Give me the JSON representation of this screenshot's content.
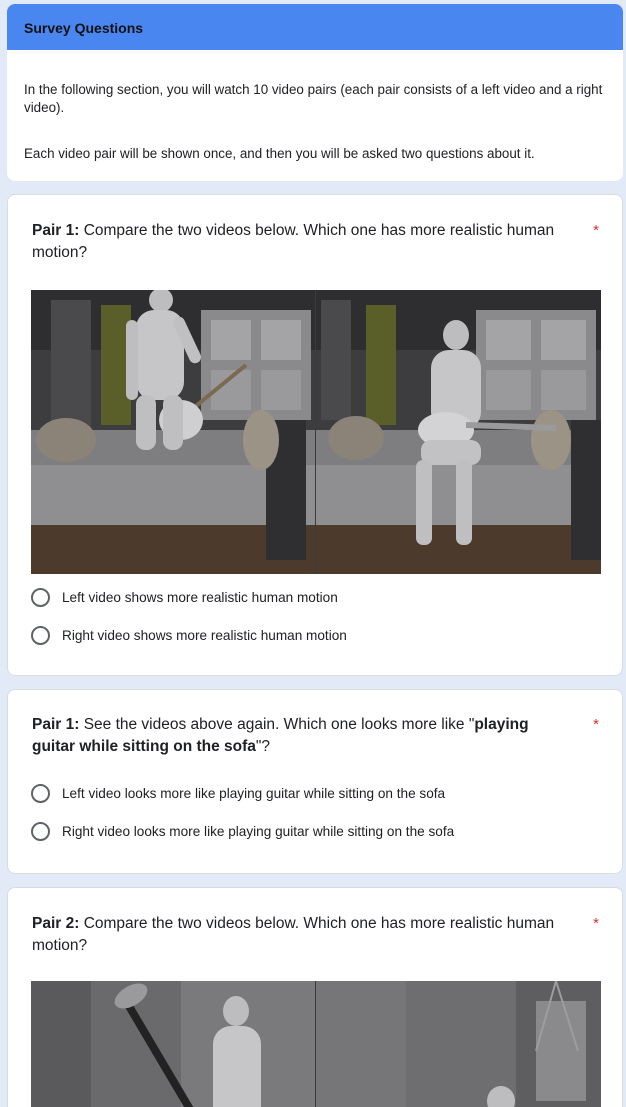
{
  "section": {
    "title": "Survey Questions",
    "intro_p1": "In the following section, you will watch 10 video pairs (each pair consists of a left video and a right video).",
    "intro_p2": "Each video pair will be shown once, and then you will be asked two questions about it."
  },
  "questions": [
    {
      "label": "Pair 1:",
      "text": " Compare the two videos below. Which one has more realistic human motion?",
      "required": "*",
      "options": [
        "Left video shows more realistic human motion",
        "Right video shows more realistic human motion"
      ]
    },
    {
      "label": "Pair 1:",
      "text_before": " See the videos above again. Which one looks more like \"",
      "emphasis": "playing guitar while sitting on the sofa",
      "text_after": "\"?",
      "required": "*",
      "options": [
        "Left video looks more like playing guitar while sitting on the sofa",
        "Right video looks more like playing guitar while sitting on the sofa"
      ]
    },
    {
      "label": "Pair 2:",
      "text": " Compare the two videos below. Which one has more realistic human motion?",
      "required": "*"
    }
  ],
  "colors": {
    "page_background": "#e2e9f7",
    "header_accent": "#4a86f0",
    "required_star": "#d93025"
  }
}
